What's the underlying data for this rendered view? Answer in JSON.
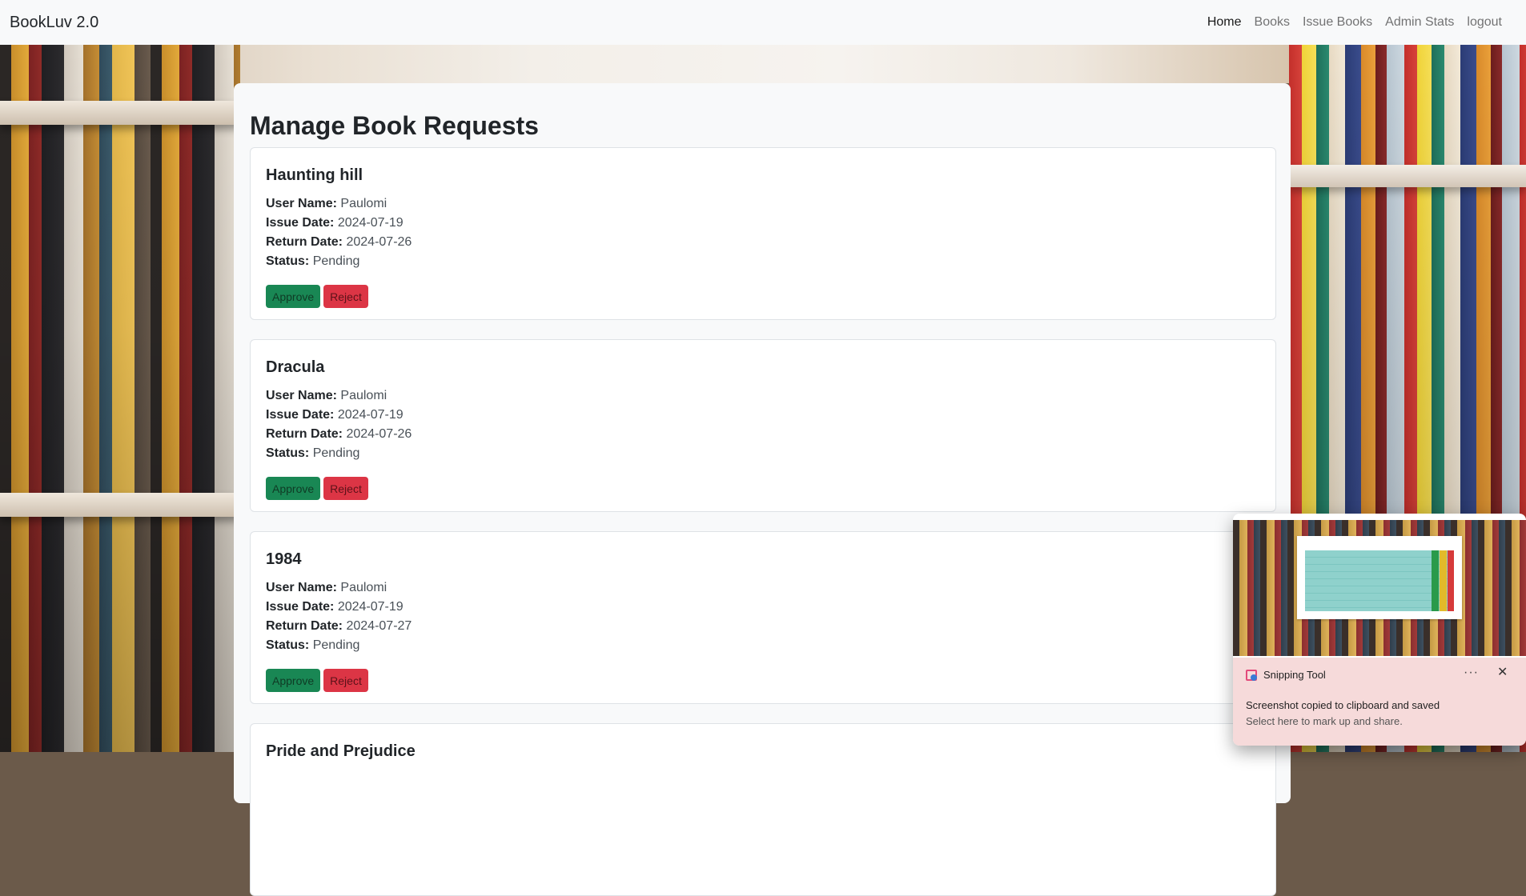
{
  "navbar": {
    "brand": "BookLuv 2.0",
    "links": [
      "Home",
      "Books",
      "Issue Books",
      "Admin Stats",
      "logout"
    ]
  },
  "page": {
    "title": "Manage Book Requests"
  },
  "labels": {
    "user_name": "User Name:",
    "issue_date": "Issue Date:",
    "return_date": "Return Date:",
    "status": "Status:",
    "approve": "Approve",
    "reject": "Reject"
  },
  "requests": [
    {
      "title": "Haunting hill",
      "user": "Paulomi",
      "issue": "2024-07-19",
      "return": "2024-07-26",
      "status": "Pending"
    },
    {
      "title": "Dracula",
      "user": "Paulomi",
      "issue": "2024-07-19",
      "return": "2024-07-26",
      "status": "Pending"
    },
    {
      "title": "1984",
      "user": "Paulomi",
      "issue": "2024-07-19",
      "return": "2024-07-27",
      "status": "Pending"
    },
    {
      "title": "Pride and Prejudice"
    }
  ],
  "toast": {
    "app": "Snipping Tool",
    "more": "···",
    "close": "✕",
    "message": "Screenshot copied to clipboard and saved",
    "sub": "Select here to mark up and share."
  },
  "colors": {
    "approve": "#198754",
    "reject": "#dc3545",
    "navbar": "#f8f9fa"
  }
}
